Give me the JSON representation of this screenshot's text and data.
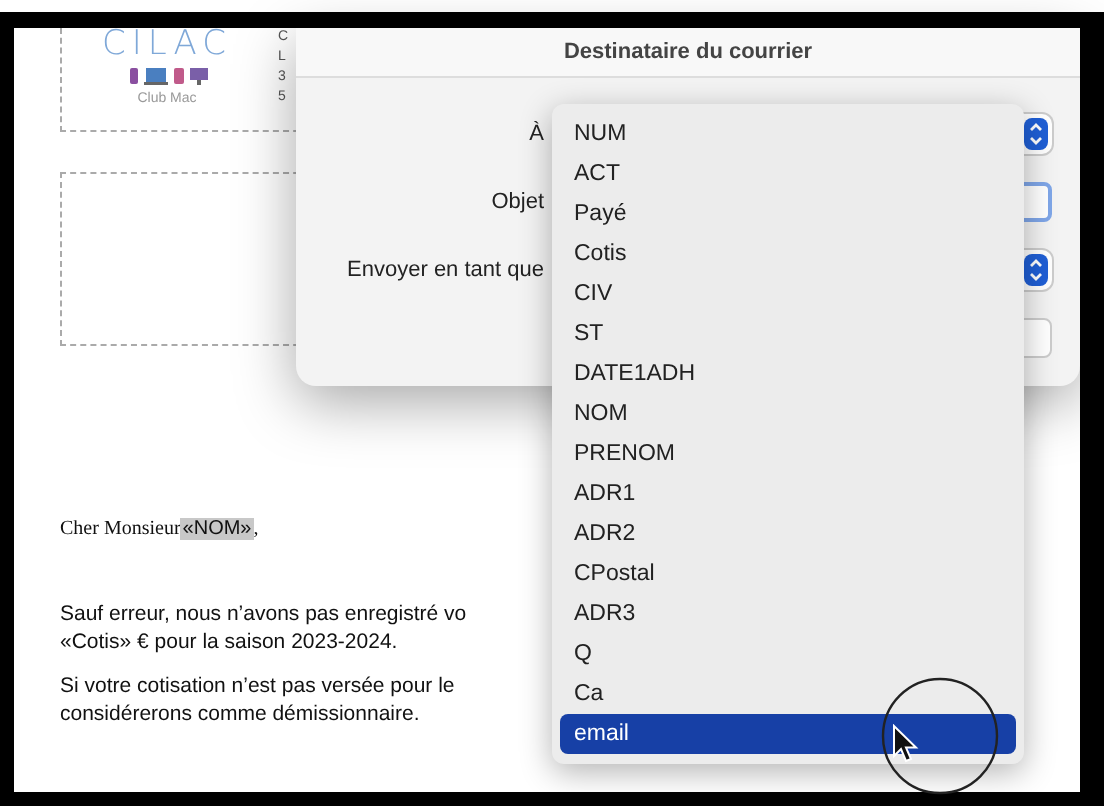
{
  "document": {
    "logo": {
      "name": "CILAC",
      "tagline": "Club Mac"
    },
    "address_fragments": [
      "C",
      "L",
      "3",
      "5"
    ],
    "salutation": {
      "prefix": "Cher Monsieur",
      "field": "«NOM»",
      "suffix": ","
    },
    "paragraphs": [
      [
        "Sauf erreur, nous n’avons pas enregistré vo",
        "«Cotis» € pour la saison 2023-2024."
      ],
      [
        "Si votre cotisation n’est pas versée pour le",
        "considérerons comme démissionnaire."
      ]
    ]
  },
  "dialog": {
    "title": "Destinataire du courrier",
    "fields": [
      {
        "label": "À",
        "kind": "popup"
      },
      {
        "label": "Objet",
        "kind": "text"
      },
      {
        "label": "Envoyer en tant que",
        "kind": "popup"
      },
      {
        "kind": "text"
      }
    ]
  },
  "menu": {
    "items": [
      {
        "label": "NUM",
        "selected": false
      },
      {
        "label": "ACT",
        "selected": false
      },
      {
        "label": "Payé",
        "selected": false
      },
      {
        "label": "Cotis",
        "selected": false
      },
      {
        "label": "CIV",
        "selected": false
      },
      {
        "label": "ST",
        "selected": false
      },
      {
        "label": "DATE1ADH",
        "selected": false
      },
      {
        "label": "NOM",
        "selected": false
      },
      {
        "label": "PRENOM",
        "selected": false
      },
      {
        "label": "ADR1",
        "selected": false
      },
      {
        "label": "ADR2",
        "selected": false
      },
      {
        "label": "CPostal",
        "selected": false
      },
      {
        "label": "ADR3",
        "selected": false
      },
      {
        "label": "Q",
        "selected": false
      },
      {
        "label": "Ca",
        "selected": false
      },
      {
        "label": "email",
        "selected": true
      }
    ]
  }
}
